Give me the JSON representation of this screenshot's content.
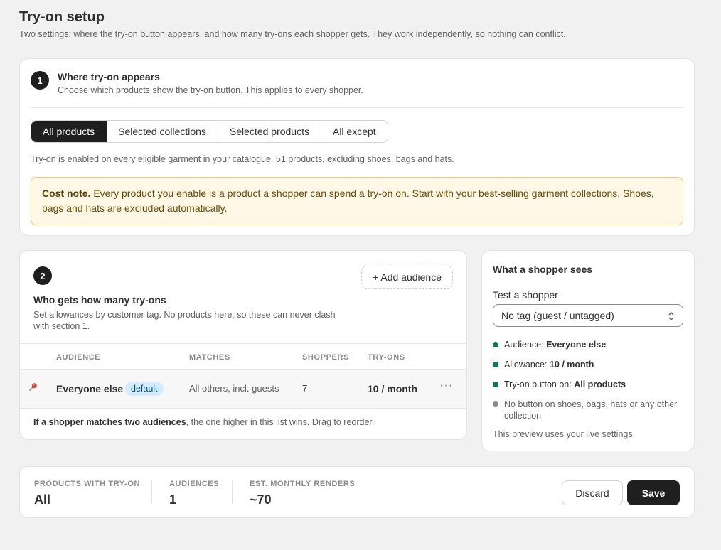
{
  "page": {
    "title": "Try-on setup",
    "subtitle": "Two settings: where the try-on button appears, and how many try-ons each shopper gets. They work independently, so nothing can conflict."
  },
  "section1": {
    "number": "1",
    "title": "Where try-on appears",
    "description": "Choose which products show the try-on button. This applies to every shopper.",
    "tabs": [
      {
        "label": "All products",
        "active": true
      },
      {
        "label": "Selected collections",
        "active": false
      },
      {
        "label": "Selected products",
        "active": false
      },
      {
        "label": "All except",
        "active": false
      }
    ],
    "scope_description": "Try-on is enabled on every eligible garment in your catalogue. 51 products, excluding shoes, bags and hats.",
    "note_label": "Cost note.",
    "note_text": " Every product you enable is a product a shopper can spend a try-on on. Start with your best-selling garment collections. Shoes, bags and hats are excluded automatically."
  },
  "section2": {
    "number": "2",
    "title": "Who gets how many try-ons",
    "description": "Set allowances by customer tag. No products here, so these can never clash with section 1.",
    "add_button": "+ Add audience",
    "columns": {
      "audience": "AUDIENCE",
      "matches": "MATCHES",
      "shoppers": "SHOPPERS",
      "tryons": "TRY-ONS"
    },
    "rows": [
      {
        "name": "Everyone else",
        "badge": "default",
        "matches": "All others, incl. guests",
        "shoppers": "7",
        "tryons": "10 / month",
        "more": "···"
      }
    ],
    "footer_bold": "If a shopper matches two audiences",
    "footer_text": ", the one higher in this list wins. Drag to reorder."
  },
  "preview": {
    "title": "What a shopper sees",
    "test_label": "Test a shopper",
    "selected": "No tag (guest / untagged)",
    "items": [
      {
        "label": "Audience: ",
        "value": "Everyone else"
      },
      {
        "label": "Allowance: ",
        "value": "10 / month"
      },
      {
        "label": "Try-on button on: ",
        "value": "All products"
      },
      {
        "label": "No button on shoes, bags, hats or any other collection",
        "value": ""
      }
    ],
    "footer": "This preview uses your live settings."
  },
  "summary": {
    "stats": [
      {
        "label": "PRODUCTS WITH TRY-ON",
        "value": "All"
      },
      {
        "label": "AUDIENCES",
        "value": "1"
      },
      {
        "label": "EST. MONTHLY RENDERS",
        "value": "~70"
      }
    ],
    "discard": "Discard",
    "save": "Save"
  },
  "colors": {
    "primary": "#1f1f1f",
    "success_dot": "#047b5d",
    "note_bg": "#fff8e6",
    "note_border": "#f0c770",
    "badge_bg": "#d5ebff"
  },
  "icons": {
    "pin": "pin-icon",
    "more": "more-horizontal-icon",
    "select_chevron": "chevron-up-down-icon"
  }
}
